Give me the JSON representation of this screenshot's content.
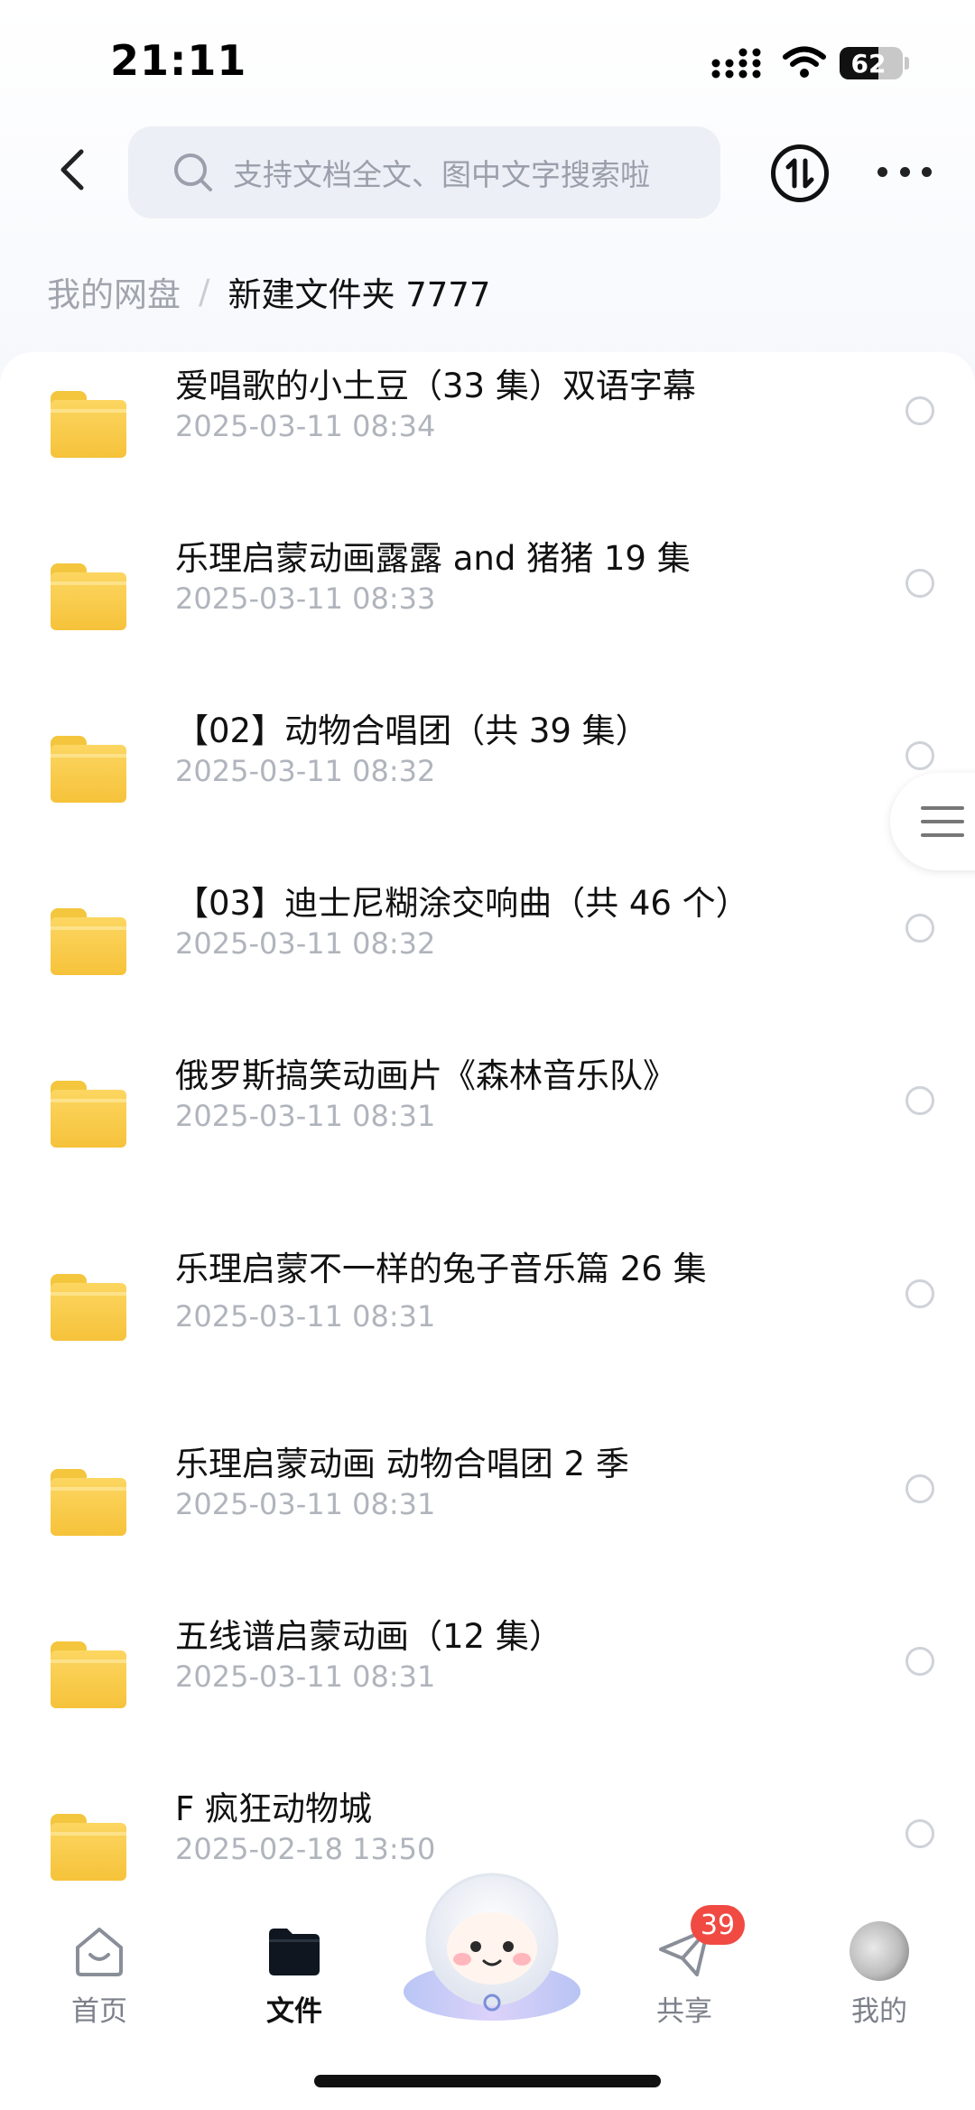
{
  "status_bar": {
    "time": "21:11",
    "battery": "62"
  },
  "header": {
    "search_placeholder": "支持文档全文、图中文字搜索啦"
  },
  "breadcrumb": {
    "root": "我的网盘",
    "separator": "/",
    "current": "新建文件夹 7777"
  },
  "files": [
    {
      "name": "爱唱歌的小土豆（33 集）双语字幕",
      "date": "2025-03-11 08:34"
    },
    {
      "name": "乐理启蒙动画露露 and 猪猪 19 集",
      "date": "2025-03-11 08:33"
    },
    {
      "name": "【02】动物合唱团（共 39 集）",
      "date": "2025-03-11 08:32"
    },
    {
      "name": "【03】迪士尼糊涂交响曲（共 46 个）",
      "date": "2025-03-11 08:32"
    },
    {
      "name": "俄罗斯搞笑动画片《森林音乐队》",
      "date": "2025-03-11 08:31"
    },
    {
      "name": "乐理启蒙不一样的兔子音乐篇 26 集",
      "date": "2025-03-11 08:31"
    },
    {
      "name": "乐理启蒙动画 动物合唱团 2 季",
      "date": "2025-03-11 08:31"
    },
    {
      "name": "五线谱启蒙动画（12 集）",
      "date": "2025-03-11 08:31"
    },
    {
      "name": "F 疯狂动物城",
      "date": "2025-02-18 13:50"
    }
  ],
  "bottom_nav": {
    "home": "首页",
    "files": "文件",
    "share": "共享",
    "share_badge": "39",
    "mine": "我的"
  }
}
